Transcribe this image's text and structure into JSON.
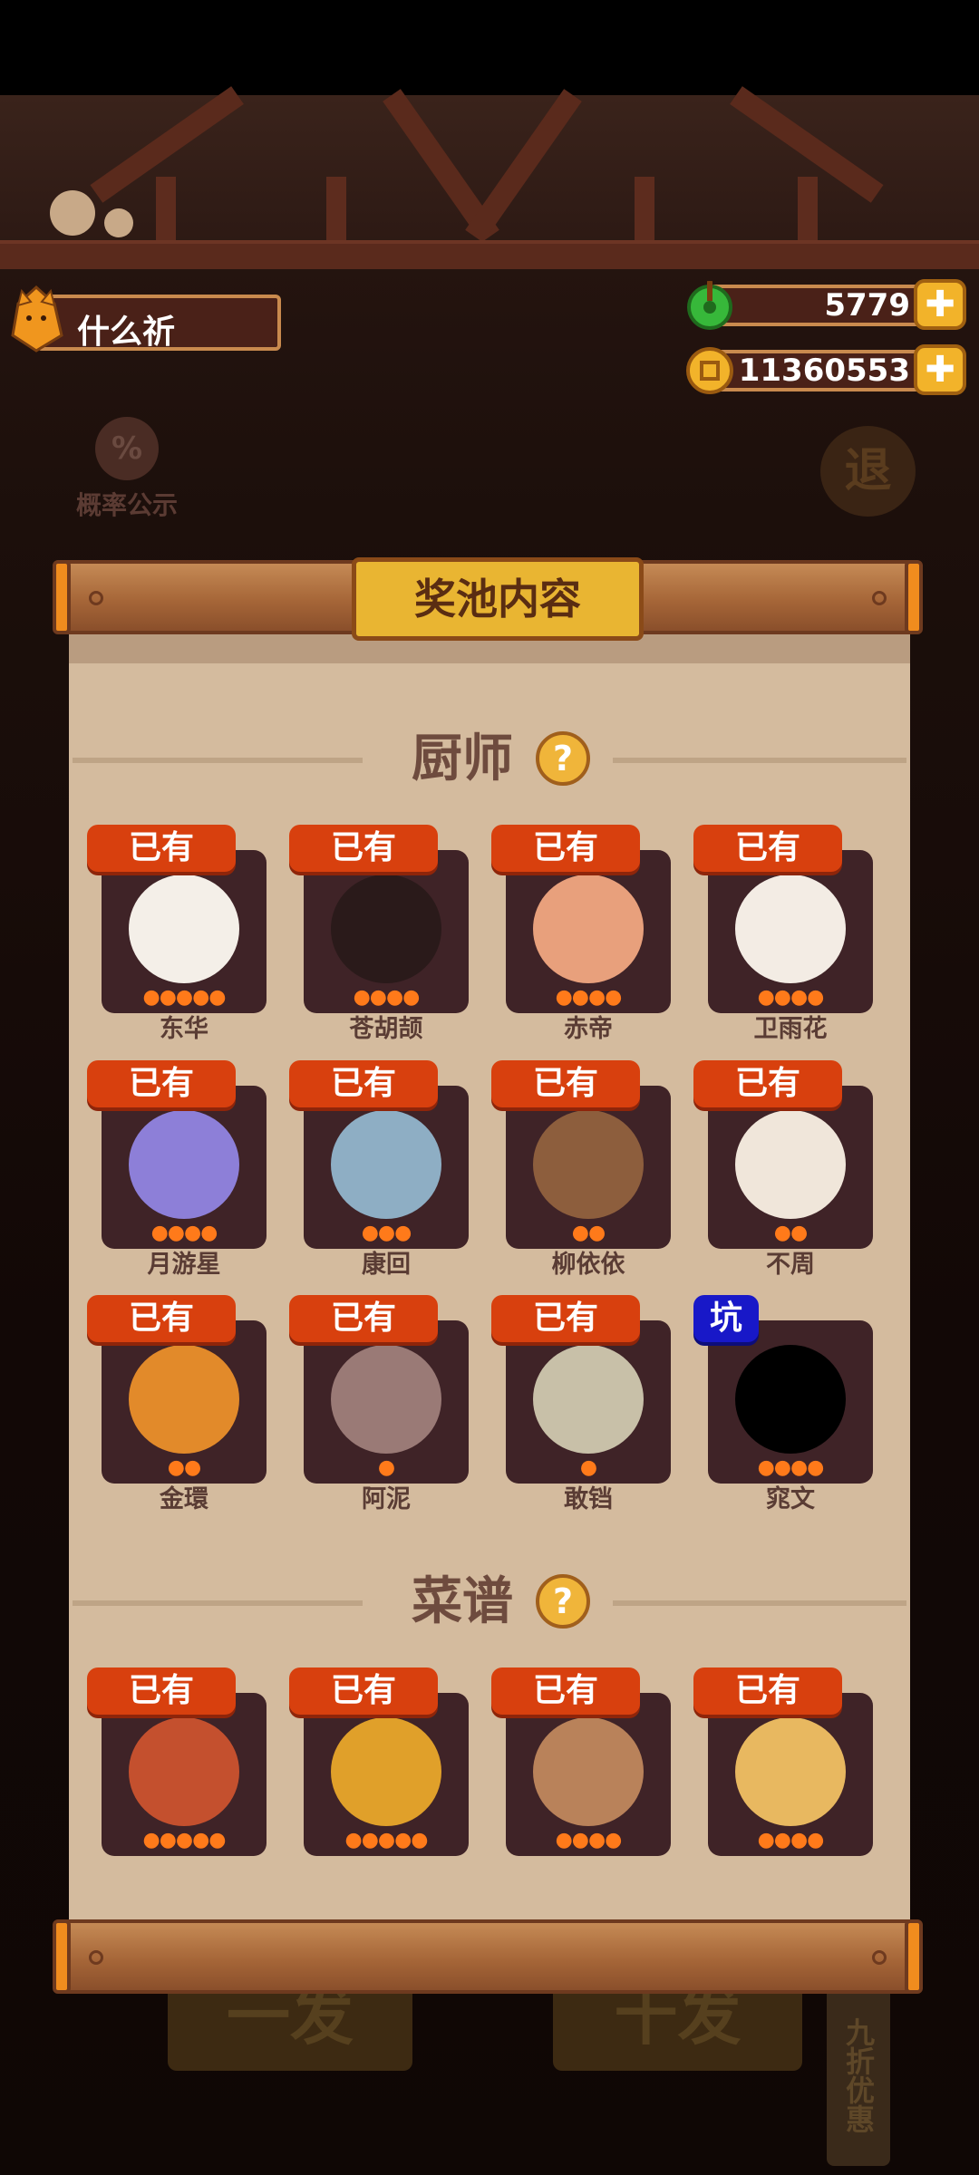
{
  "player": {
    "name": "什么祈"
  },
  "currency": {
    "jade": "5779",
    "coins": "11360553",
    "plus_symbol": "✚"
  },
  "side_buttons": {
    "probability_label": "概率公示",
    "probability_icon": "%",
    "exit_label": "退"
  },
  "bottom": {
    "single": "一发",
    "ten": "十发",
    "discount": "九折优惠"
  },
  "panel": {
    "title": "奖池内容",
    "help_symbol": "?",
    "chef_section": "厨师",
    "recipe_section": "菜谱"
  },
  "chefs": [
    {
      "tag": "已有",
      "name": "东华",
      "stars": 5
    },
    {
      "tag": "已有",
      "name": "苍胡颉",
      "stars": 4
    },
    {
      "tag": "已有",
      "name": "赤帝",
      "stars": 4
    },
    {
      "tag": "已有",
      "name": "卫雨花",
      "stars": 4
    },
    {
      "tag": "已有",
      "name": "月游星",
      "stars": 4
    },
    {
      "tag": "已有",
      "name": "康回",
      "stars": 3
    },
    {
      "tag": "已有",
      "name": "柳依依",
      "stars": 2
    },
    {
      "tag": "已有",
      "name": "不周",
      "stars": 2
    },
    {
      "tag": "已有",
      "name": "金環",
      "stars": 2
    },
    {
      "tag": "已有",
      "name": "阿泥",
      "stars": 1
    },
    {
      "tag": "已有",
      "name": "敢铛",
      "stars": 1
    },
    {
      "tag": "坑",
      "name": "窕文",
      "stars": 4
    }
  ],
  "recipes": [
    {
      "tag": "已有",
      "stars": 5
    },
    {
      "tag": "已有",
      "stars": 5
    },
    {
      "tag": "已有",
      "stars": 4
    },
    {
      "tag": "已有",
      "stars": 4
    }
  ],
  "colors": {
    "owned_tag": "#d8400e",
    "pit_tag": "#1818c8",
    "panel_bg": "#d4bb9e",
    "card_bg": "#3f2327"
  }
}
